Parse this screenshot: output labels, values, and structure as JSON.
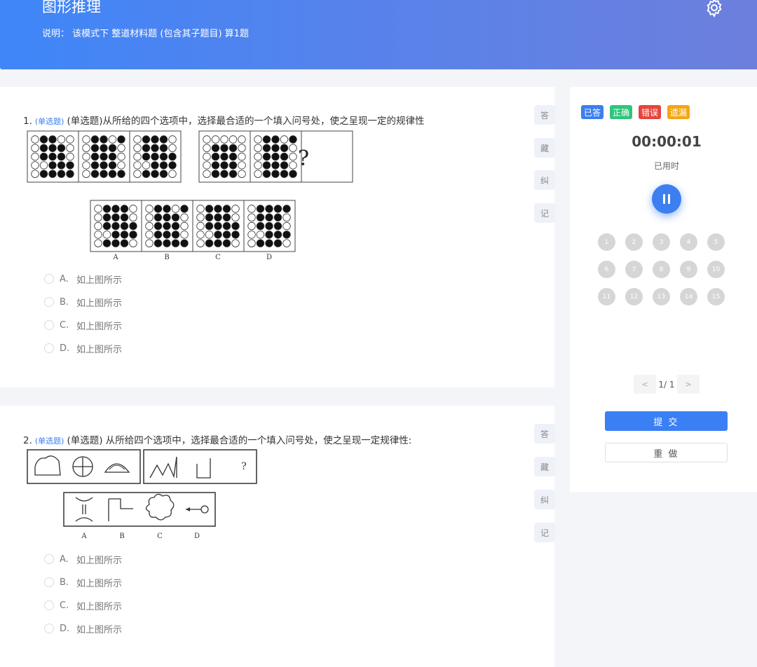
{
  "header": {
    "title": "图形推理",
    "description": "说明： 该模式下 整道材料题 (包含其子题目) 算1题"
  },
  "questions": [
    {
      "number": "1.",
      "tag": "(单选题)",
      "text": "(单选题)从所给的四个选项中，选择最合适的一个填入问号处，使之呈现一定的规律性",
      "question_mark": "?",
      "figure_labels": [
        "A",
        "B",
        "C",
        "D"
      ],
      "options": [
        {
          "letter": "A.",
          "text": "如上图所示"
        },
        {
          "letter": "B.",
          "text": "如上图所示"
        },
        {
          "letter": "C.",
          "text": "如上图所示"
        },
        {
          "letter": "D.",
          "text": "如上图所示"
        }
      ]
    },
    {
      "number": "2.",
      "tag": "(单选题)",
      "text": "(单选题) 从所给四个选项中，选择最合适的一个填入问号处，使之呈现一定规律性:",
      "question_mark": "?",
      "figure_labels": [
        "A",
        "B",
        "C",
        "D"
      ],
      "options": [
        {
          "letter": "A.",
          "text": "如上图所示"
        },
        {
          "letter": "B.",
          "text": "如上图所示"
        },
        {
          "letter": "C.",
          "text": "如上图所示"
        },
        {
          "letter": "D.",
          "text": "如上图所示"
        }
      ]
    }
  ],
  "side_buttons": [
    "答",
    "藏",
    "纠",
    "记"
  ],
  "panel": {
    "legend": [
      {
        "label": "已答",
        "color": "#3b7ff0"
      },
      {
        "label": "正确",
        "color": "#2fc57a"
      },
      {
        "label": "错误",
        "color": "#e6443d"
      },
      {
        "label": "遗漏",
        "color": "#f2a716"
      }
    ],
    "timer": "00:00:01",
    "timer_label": "已用时",
    "question_numbers": [
      "1",
      "2",
      "3",
      "4",
      "5",
      "6",
      "7",
      "8",
      "9",
      "10",
      "11",
      "12",
      "13",
      "14",
      "15"
    ],
    "pager": {
      "prev": "<",
      "text": "1/ 1",
      "next": ">"
    },
    "submit_label": "提 交",
    "redo_label": "重 做"
  }
}
